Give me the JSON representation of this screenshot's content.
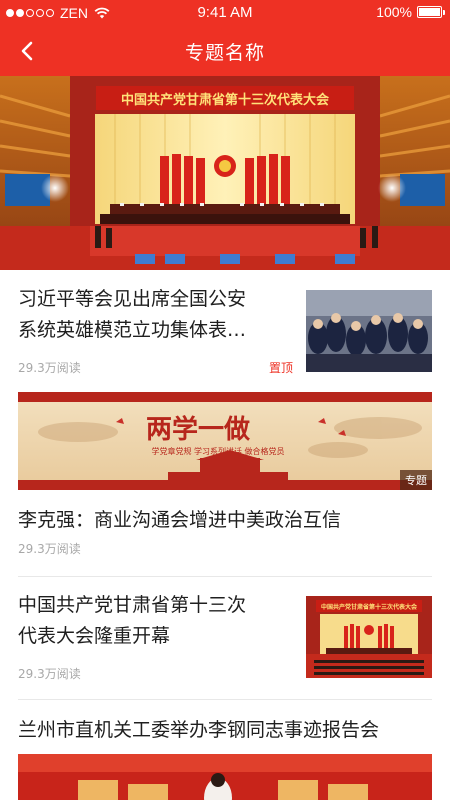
{
  "status_bar": {
    "carrier": "ZEN",
    "time": "9:41 AM",
    "battery": "100%",
    "signal_bars_filled": 2,
    "signal_bars_total": 5
  },
  "nav": {
    "title": "专题名称",
    "back_icon": "chevron-left-icon"
  },
  "hero": {
    "banner_text": "中国共产党甘肃省第十三次代表大会"
  },
  "articles": [
    {
      "title_line1": "习近平等会见出席全国公安",
      "title_line2": "系统英雄模范立功集体表…",
      "reads": "29.3万阅读",
      "tag": "置顶"
    },
    {
      "title": "李克强：商业沟通会增进中美政治互信",
      "reads": "29.3万阅读"
    },
    {
      "title_line1": "中国共产党甘肃省第十三次",
      "title_line2": "代表大会隆重开幕",
      "reads": "29.3万阅读",
      "thumb_text": "中国共产党甘肃省第十三次代表大会"
    },
    {
      "title": "兰州市直机关工委举办李钢同志事迹报告会"
    }
  ],
  "banner": {
    "headline": "两学一做",
    "subline": "学党章党规  学习系列讲话  做合格党员",
    "tag": "专题"
  },
  "colors": {
    "brand_red": "#ee3124",
    "meta_gray": "#a8a8a8",
    "divider": "#e8e8e8"
  }
}
